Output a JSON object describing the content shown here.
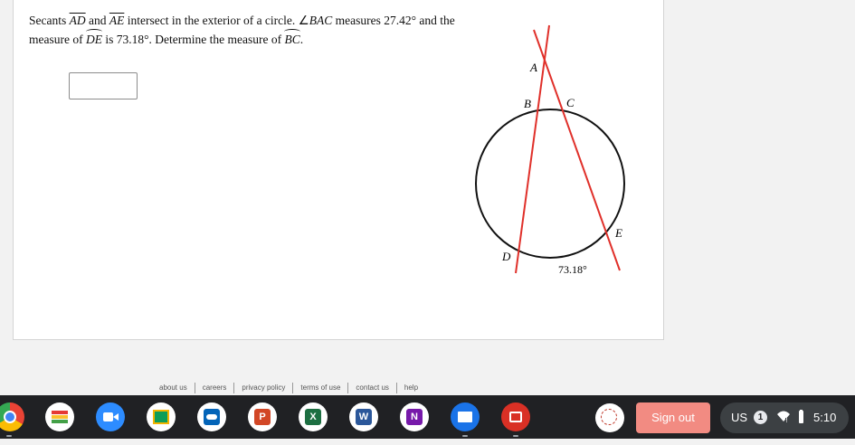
{
  "question": {
    "p1": "Secants ",
    "seg1": "AD",
    "p2": " and ",
    "seg2": "AE",
    "p3": " intersect in the exterior of a circle. ∠",
    "angle": "BAC",
    "p4": " measures 27.42° and the measure of ",
    "arc1": "DE",
    "p5": " is 73.18°. Determine the measure of ",
    "arc2": "BC",
    "p6": "."
  },
  "answer": {
    "value": ""
  },
  "diagram": {
    "labels": {
      "A": "A",
      "B": "B",
      "C": "C",
      "D": "D",
      "E": "E"
    },
    "arc_label": "73.18°"
  },
  "footer": {
    "links": [
      "about us",
      "careers",
      "privacy policy",
      "terms of use",
      "contact us",
      "help"
    ]
  },
  "shelf": {
    "apps": [
      "chrome-icon",
      "books-icon",
      "zoom-icon",
      "classroom-icon",
      "onedrive-icon",
      "powerpoint-icon",
      "excel-icon",
      "word-icon",
      "onenote-icon",
      "files-icon",
      "gallery-icon"
    ],
    "app_letters": {
      "powerpoint": "P",
      "excel": "X",
      "word": "W",
      "onenote": "N"
    },
    "sign_out": "Sign out",
    "tray": {
      "keyboard": "US",
      "notifications": "1",
      "time": "5:10"
    },
    "colors": {
      "sign_out": "#f28b82",
      "shelf": "#202124"
    }
  }
}
